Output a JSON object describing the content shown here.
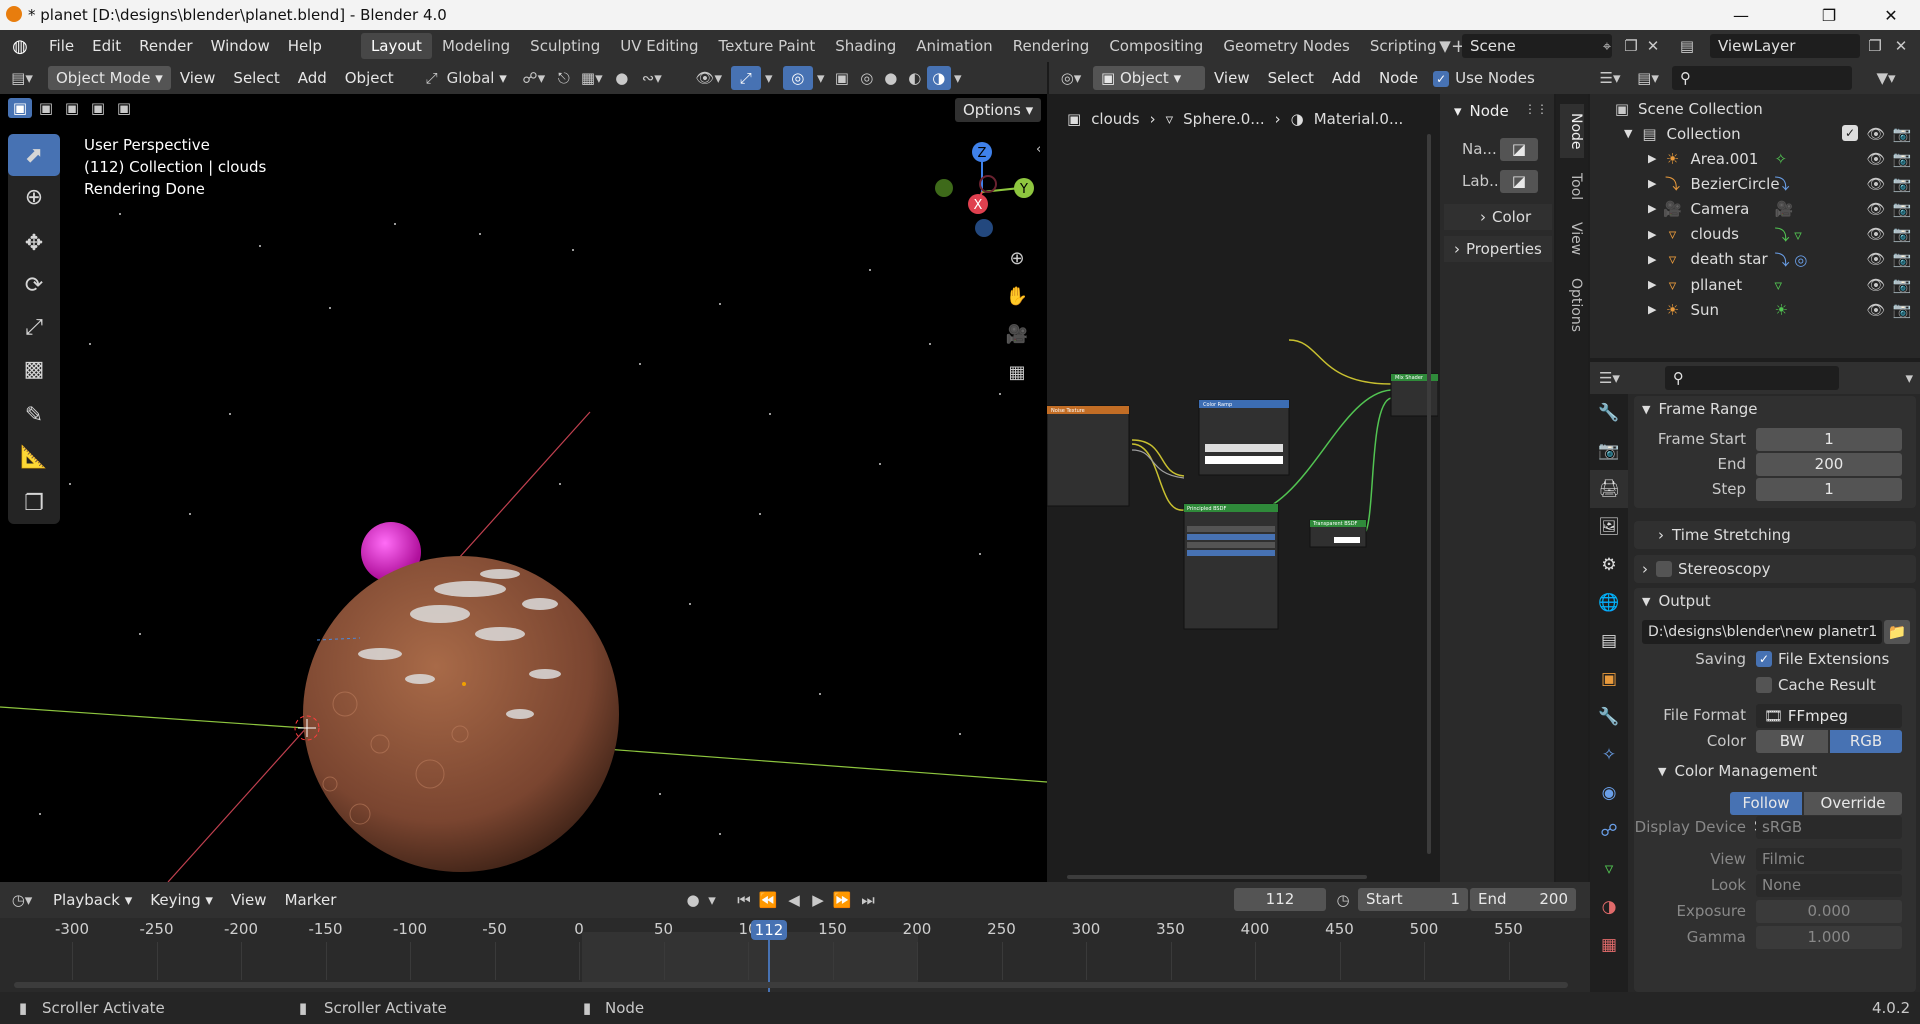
{
  "window": {
    "title": "* planet [D:\\designs\\blender\\planet.blend] - Blender 4.0"
  },
  "menu": [
    "File",
    "Edit",
    "Render",
    "Window",
    "Help"
  ],
  "workspaces": [
    "Layout",
    "Modeling",
    "Sculpting",
    "UV Editing",
    "Texture Paint",
    "Shading",
    "Animation",
    "Rendering",
    "Compositing",
    "Geometry Nodes",
    "Scripting"
  ],
  "scene": {
    "name": "Scene",
    "view_layer": "ViewLayer"
  },
  "viewport": {
    "mode": "Object Mode",
    "menus": [
      "View",
      "Select",
      "Add",
      "Object"
    ],
    "transform": "Global",
    "options": "Options",
    "overlay_lines": [
      "User Perspective",
      "(112) Collection | clouds",
      "Rendering Done"
    ]
  },
  "gizmo": {
    "x": "X",
    "y": "Y",
    "z": "Z"
  },
  "node_editor": {
    "type": "Object",
    "menus": [
      "View",
      "Select",
      "Add",
      "Node"
    ],
    "use_nodes": "Use Nodes",
    "breadcrumb": [
      "clouds",
      "Sphere.0...",
      "Material.0..."
    ],
    "panel_title": "Node",
    "name_label": "Na...",
    "label_label": "Lab...",
    "color_label": "Color",
    "properties_label": "Properties",
    "side_tabs": [
      "Node",
      "Tool",
      "View",
      "Options"
    ],
    "node_titles": [
      "Noise Texture",
      "Color Ramp",
      "Principled BSDF",
      "Transparent BSDF",
      "Mix Shader"
    ]
  },
  "outliner": {
    "root": "Scene Collection",
    "collection": "Collection",
    "items": [
      "Area.001",
      "BezierCircle",
      "Camera",
      "clouds",
      "death star",
      "pllanet",
      "Sun"
    ]
  },
  "properties": {
    "frame_range": {
      "title": "Frame Range",
      "start_label": "Frame Start",
      "start": "1",
      "end_label": "End",
      "end": "200",
      "step_label": "Step",
      "step": "1"
    },
    "time_stretching": "Time Stretching",
    "stereoscopy": "Stereoscopy",
    "output": {
      "title": "Output",
      "path": "D:\\designs\\blender\\new planetr1",
      "saving_label": "Saving",
      "file_extensions": "File Extensions",
      "cache_result": "Cache Result",
      "file_format_label": "File Format",
      "file_format": "FFmpeg Video",
      "color_label": "Color",
      "bw": "BW",
      "rgb": "RGB"
    },
    "color_management": {
      "title": "Color Management",
      "follow": "Follow S...",
      "override": "Override",
      "display_device_label": "Display Device",
      "display_device": "sRGB",
      "view_label": "View",
      "view": "Filmic",
      "look_label": "Look",
      "look": "None",
      "exposure_label": "Exposure",
      "exposure": "0.000",
      "gamma_label": "Gamma",
      "gamma": "1.000"
    }
  },
  "timeline": {
    "menus": [
      "Playback",
      "Keying",
      "View",
      "Marker"
    ],
    "current": "112",
    "start_label": "Start",
    "start": "1",
    "end_label": "End",
    "end": "200",
    "ruler": [
      "-300",
      "-250",
      "-200",
      "-150",
      "-100",
      "-50",
      "0",
      "50",
      "10",
      "150",
      "200",
      "250",
      "300",
      "350",
      "400",
      "450",
      "500",
      "550"
    ]
  },
  "statusbar": {
    "left": "Scroller Activate",
    "middle": "Scroller Activate",
    "right": "Node",
    "version": "4.0.2"
  },
  "colors": {
    "accent": "#4772b3",
    "x_axis": "#e0404f",
    "y_axis": "#8ec63f",
    "z_axis": "#3f81ea",
    "planet": "#8a5236",
    "moon": "#d020c8"
  }
}
